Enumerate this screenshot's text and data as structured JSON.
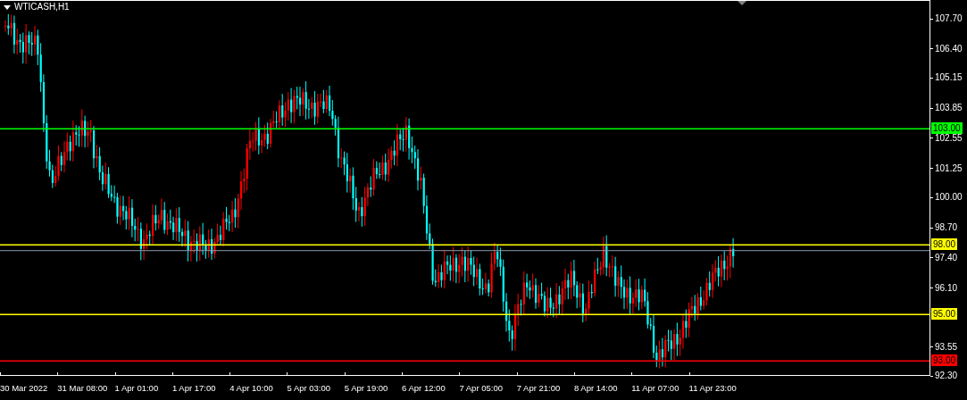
{
  "chart": {
    "title": "WTICASH,H1"
  },
  "price_axis": {
    "ticks": [
      "107.70",
      "106.40",
      "105.15",
      "103.85",
      "102.55",
      "101.25",
      "100.00",
      "98.70",
      "97.40",
      "96.10",
      "93.55",
      "92.30"
    ]
  },
  "levels": [
    {
      "label": "103.00",
      "color": "#00ff00"
    },
    {
      "label": "98.00",
      "color": "#ffff00"
    },
    {
      "label": "95.00",
      "color": "#ffff00"
    },
    {
      "label": "93.00",
      "color": "#ff0000"
    }
  ],
  "time_axis": {
    "labels": [
      "30 Mar 2022",
      "31 Mar 08:00",
      "1 Apr 01:00",
      "1 Apr 17:00",
      "4 Apr 10:00",
      "5 Apr 03:00",
      "5 Apr 19:00",
      "6 Apr 12:00",
      "7 Apr 05:00",
      "7 Apr 21:00",
      "8 Apr 14:00",
      "11 Apr 07:00",
      "11 Apr 23:00"
    ]
  }
}
